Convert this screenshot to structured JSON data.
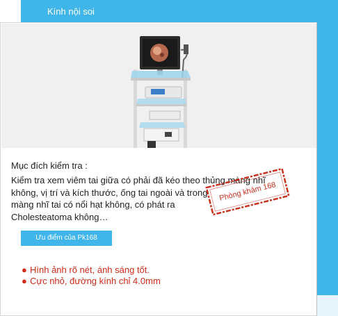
{
  "header": {
    "title": "Kính nội soi"
  },
  "card": {
    "image": {
      "description": "endoscope-tower"
    },
    "purpose_label": "Mục đích kiểm tra :",
    "description_lines": [
      "Kiểm tra xem viêm tai giữa có phải đã kéo theo thủng màng nhĩ",
      "không, vị trí và kích thước, ống tai ngoài và trong",
      "màng nhĩ tai có nổi hạt không, có phát ra",
      "Cholesteatoma không…"
    ],
    "advantages_button": "Ưu điểm của Pk168",
    "advantages": [
      "Hình ảnh rõ nét, ánh sáng tốt.",
      "Cực nhỏ, đường kính chỉ 4.0mm"
    ],
    "stamp": "Phòng khám 168"
  },
  "colors": {
    "accent": "#3fb5ea",
    "bullet_text": "#cf2a1a",
    "stamp": "#c8321e"
  }
}
